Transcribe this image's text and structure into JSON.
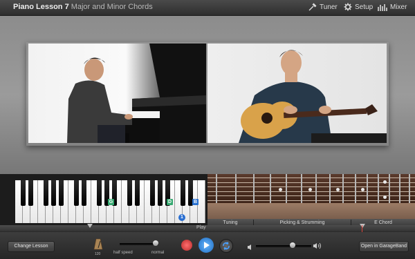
{
  "window": {
    "title": "Piano Lesson 7",
    "subtitle": "Major and Minor Chords"
  },
  "toolbar": {
    "tuner_label": "Tuner",
    "setup_label": "Setup",
    "mixer_label": "Mixer"
  },
  "keyboard": {
    "highlighted_labels": [
      "G",
      "D",
      "B"
    ],
    "finger_number": "1"
  },
  "sections": {
    "play_label": "Play",
    "items": [
      "Tuning",
      "Picking & Strumming",
      "E Chord"
    ]
  },
  "bottom": {
    "change_lesson_label": "Change Lesson",
    "metronome_value": "120",
    "speed_min_label": "half speed",
    "speed_max_label": "normal",
    "speed_value": 1.0,
    "volume_value": 0.68,
    "open_garageband_label": "Open in GarageBand"
  },
  "colors": {
    "play_button": "#2b8fe0",
    "record_button": "#d23a3a",
    "highlight_green": "#35a870",
    "highlight_blue": "#2a72d0"
  },
  "icons": [
    "tuner-icon",
    "gear-icon",
    "mixer-icon",
    "metronome-icon",
    "record-icon",
    "play-icon",
    "loop-icon",
    "volume-low-icon",
    "volume-high-icon"
  ]
}
